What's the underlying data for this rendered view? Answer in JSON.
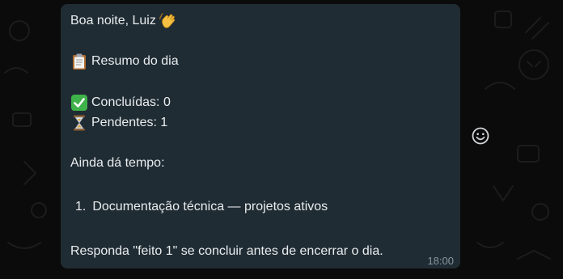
{
  "message": {
    "greeting": "Boa noite, Luiz",
    "greeting_icon": "waving-hand-icon",
    "summary_title": "Resumo do dia",
    "summary_icon": "clipboard-icon",
    "completed_label": "Concluídas: 0",
    "completed_icon": "check-mark-icon",
    "pending_label": "Pendentes: 1",
    "pending_icon": "hourglass-icon",
    "still_time": "Ainda dá tempo:",
    "items": [
      {
        "number": "1.",
        "text": "Documentação técnica — projetos ativos"
      }
    ],
    "instruction": "Responda \"feito 1\" se concluir antes de encerrar o dia.",
    "timestamp": "18:00"
  },
  "reaction_button_icon": "smiley-icon",
  "colors": {
    "bubble": "#202c33",
    "text": "#e9edef",
    "timestamp": "#8696a0",
    "background": "#0b0b0b"
  }
}
